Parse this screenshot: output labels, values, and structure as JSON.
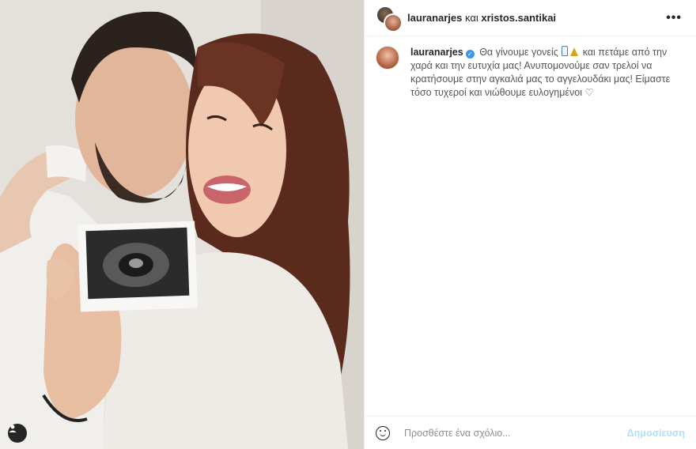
{
  "header": {
    "username": "lauranarjes",
    "conjunction": "και",
    "collaborator": "xristos.santikai",
    "more_icon": "more-horizontal-icon"
  },
  "caption": {
    "username": "lauranarjes",
    "verified_icon": "verified-badge-icon",
    "text_1": "Θα γίνουμε γονείς",
    "emoji": [
      "baby-bottle-emoji",
      "party-popper-emoji"
    ],
    "text_2": "και πετάμε από την χαρά και την ευτυχία μας! Ανυπομονούμε σαν τρελοί να κρατήσουμε στην αγκαλιά μας το αγγελουδάκι μας! Είμαστε τόσο τυχεροί και νιώθουμε ευλογημένοι",
    "heart": "♡"
  },
  "comment_bar": {
    "emoji_icon": "emoji-smile-icon",
    "placeholder": "Προσθέστε ένα σχόλιο...",
    "post_label": "Δημοσίευση"
  },
  "photo": {
    "user_tag_icon": "user-tag-icon"
  },
  "colors": {
    "accent": "#3897f0",
    "post_disabled": "#b2dffc",
    "border": "#efefef"
  }
}
